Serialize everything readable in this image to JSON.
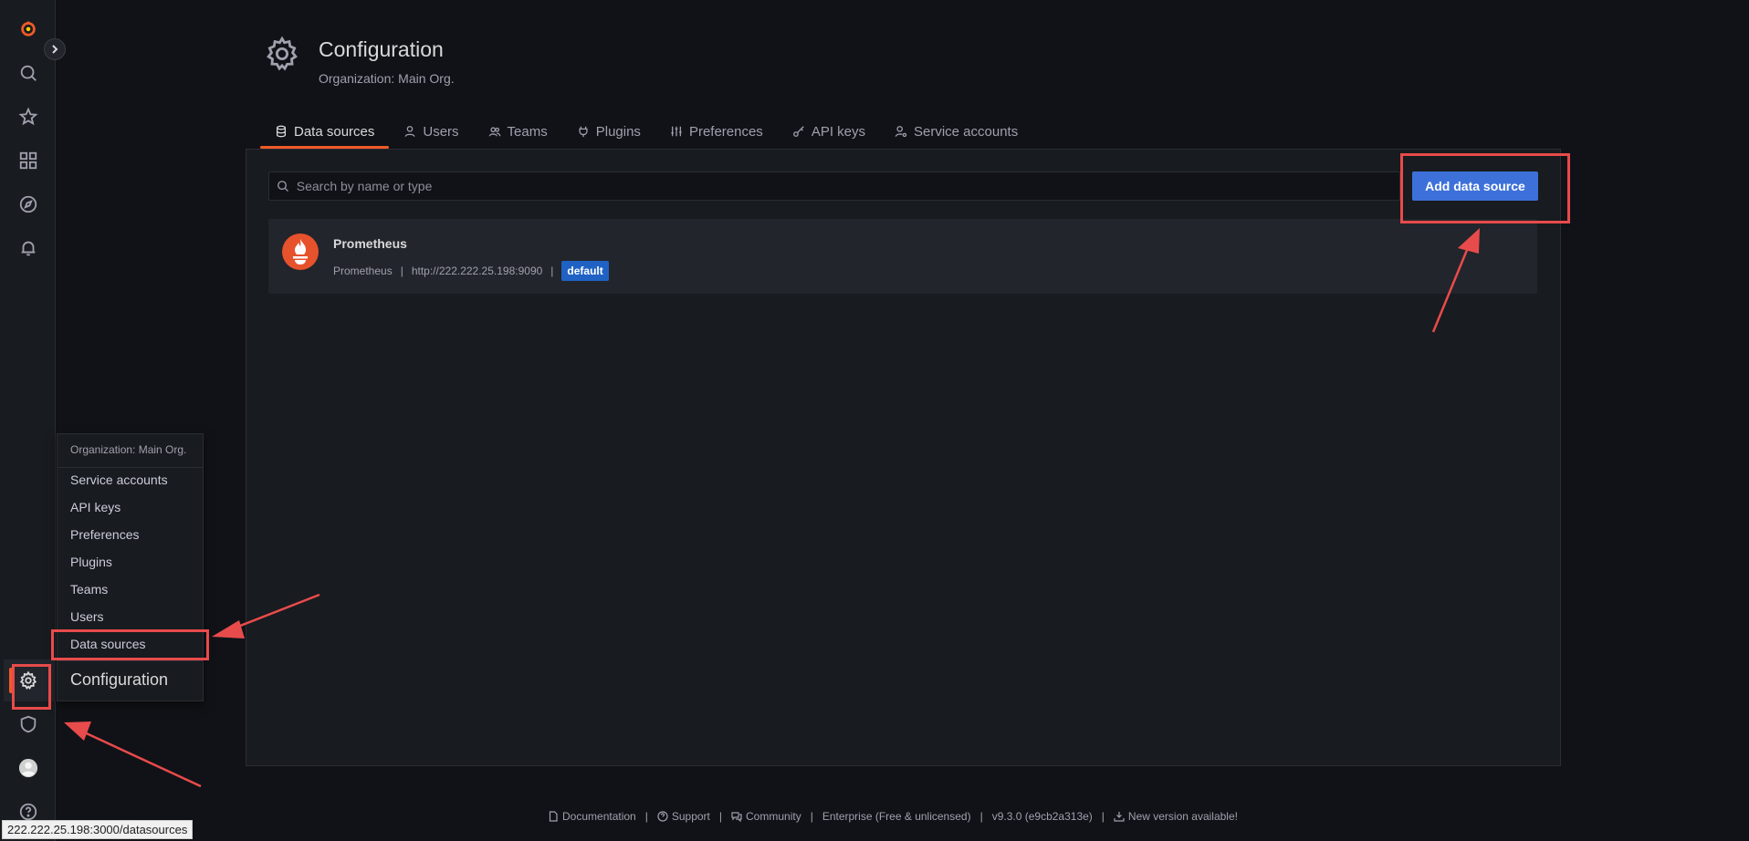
{
  "header": {
    "title": "Configuration",
    "subtitle": "Organization: Main Org."
  },
  "tabs": [
    {
      "label": "Data sources",
      "icon": "database-icon",
      "active": true
    },
    {
      "label": "Users",
      "icon": "user-icon"
    },
    {
      "label": "Teams",
      "icon": "users-icon"
    },
    {
      "label": "Plugins",
      "icon": "plug-icon"
    },
    {
      "label": "Preferences",
      "icon": "sliders-icon"
    },
    {
      "label": "API keys",
      "icon": "key-icon"
    },
    {
      "label": "Service accounts",
      "icon": "user-cog-icon"
    }
  ],
  "search": {
    "placeholder": "Search by name or type",
    "value": ""
  },
  "add_button": {
    "label": "Add data source"
  },
  "datasource": {
    "name": "Prometheus",
    "type": "Prometheus",
    "url": "http://222.222.25.198:9090",
    "badge": "default",
    "sep": "|"
  },
  "flyout": {
    "org": "Organization: Main Org.",
    "items": [
      "Service accounts",
      "API keys",
      "Preferences",
      "Plugins",
      "Teams",
      "Users",
      "Data sources"
    ],
    "title": "Configuration"
  },
  "footer": {
    "documentation": "Documentation",
    "support": "Support",
    "community": "Community",
    "edition": "Enterprise (Free & unlicensed)",
    "version": "v9.3.0 (e9cb2a313e)",
    "new_version": "New version available!",
    "sep": "|"
  },
  "status_bar": {
    "url": "222.222.25.198:3000/datasources"
  },
  "colors": {
    "accent": "#f05a28",
    "primary": "#3d71d9",
    "badge": "#1f62c4",
    "annotation": "#e84b4b",
    "background": "#111217",
    "panel": "#181b1f"
  }
}
